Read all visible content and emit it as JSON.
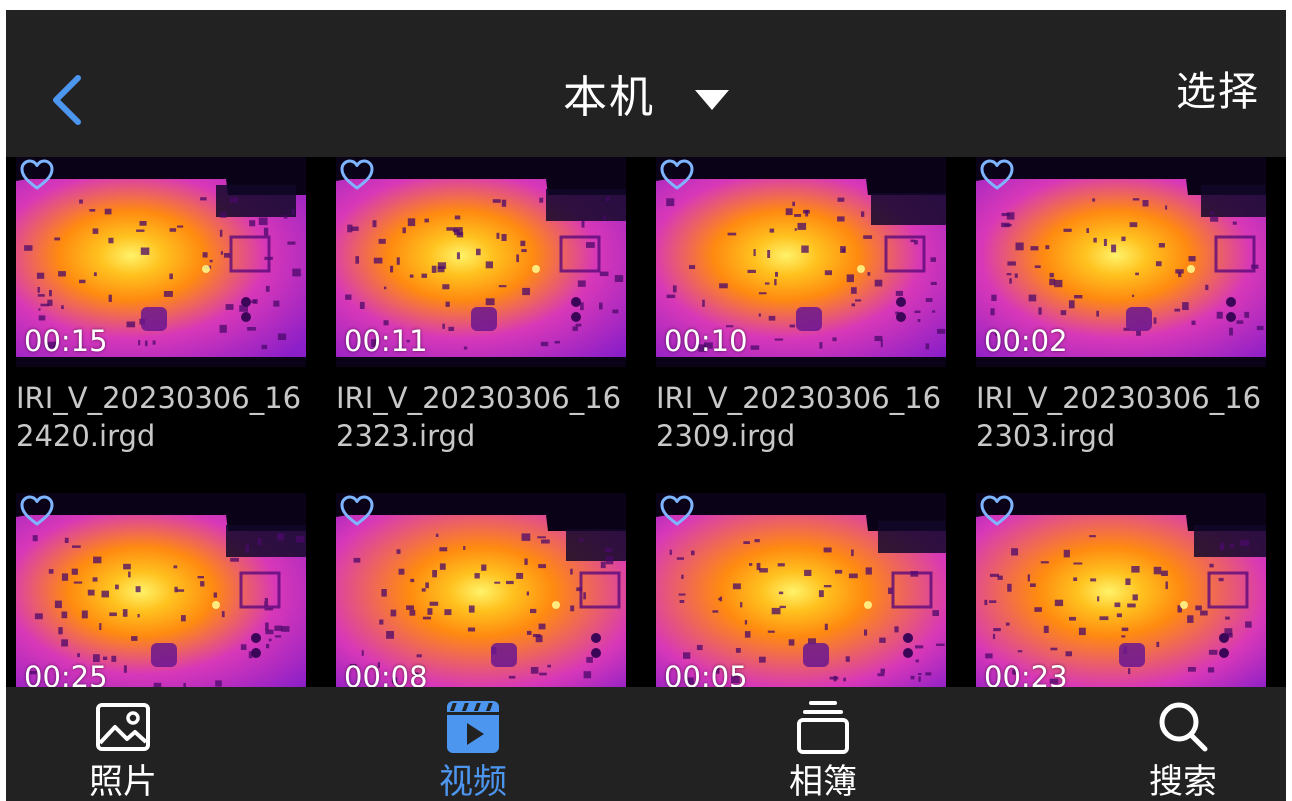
{
  "header": {
    "title": "本机",
    "select_label": "选择"
  },
  "videos": [
    {
      "duration": "00:15",
      "name": "IRI_V_20230306_162420.irgd"
    },
    {
      "duration": "00:11",
      "name": "IRI_V_20230306_162323.irgd"
    },
    {
      "duration": "00:10",
      "name": "IRI_V_20230306_162309.irgd"
    },
    {
      "duration": "00:02",
      "name": "IRI_V_20230306_162303.irgd"
    },
    {
      "duration": "00:25",
      "name": ""
    },
    {
      "duration": "00:08",
      "name": ""
    },
    {
      "duration": "00:05",
      "name": ""
    },
    {
      "duration": "00:23",
      "name": ""
    }
  ],
  "nav": {
    "photos": "照片",
    "videos": "视频",
    "albums": "相簿",
    "search": "搜索"
  },
  "colors": {
    "accent": "#4d96f0",
    "bar_bg": "#222222",
    "content_bg": "#000000"
  }
}
